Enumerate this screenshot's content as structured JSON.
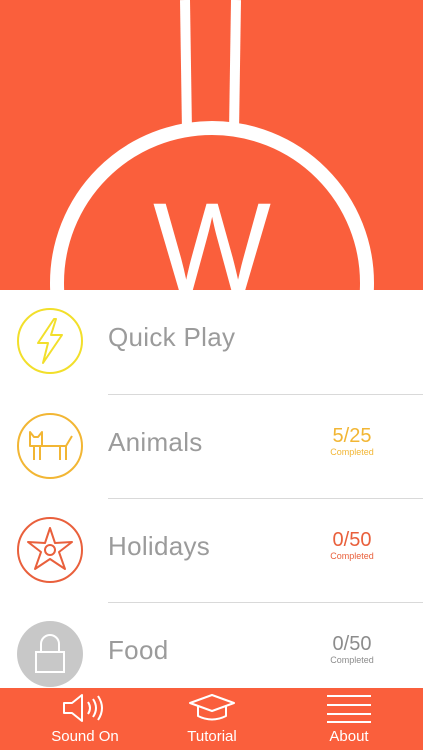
{
  "colors": {
    "brand": "#fa5f3c",
    "quick_play": "#f2df2b",
    "animals": "#f2b634",
    "holidays": "#e9603c",
    "food_locked": "#c8c8c8",
    "text_gray": "#9b9b9b"
  },
  "logo": {
    "letter": "W"
  },
  "menu": {
    "items": [
      {
        "label": "Quick Play",
        "icon": "lightning-icon",
        "count": "",
        "sub": ""
      },
      {
        "label": "Animals",
        "icon": "cat-icon",
        "count": "5/25",
        "sub": "Completed"
      },
      {
        "label": "Holidays",
        "icon": "flower-icon",
        "count": "0/50",
        "sub": "Completed"
      },
      {
        "label": "Food",
        "icon": "lock-icon",
        "count": "0/50",
        "sub": "Completed"
      }
    ]
  },
  "tabbar": {
    "items": [
      {
        "label": "Sound On",
        "icon": "speaker-icon"
      },
      {
        "label": "Tutorial",
        "icon": "graduation-cap-icon"
      },
      {
        "label": "About",
        "icon": "menu-lines-icon"
      }
    ]
  }
}
